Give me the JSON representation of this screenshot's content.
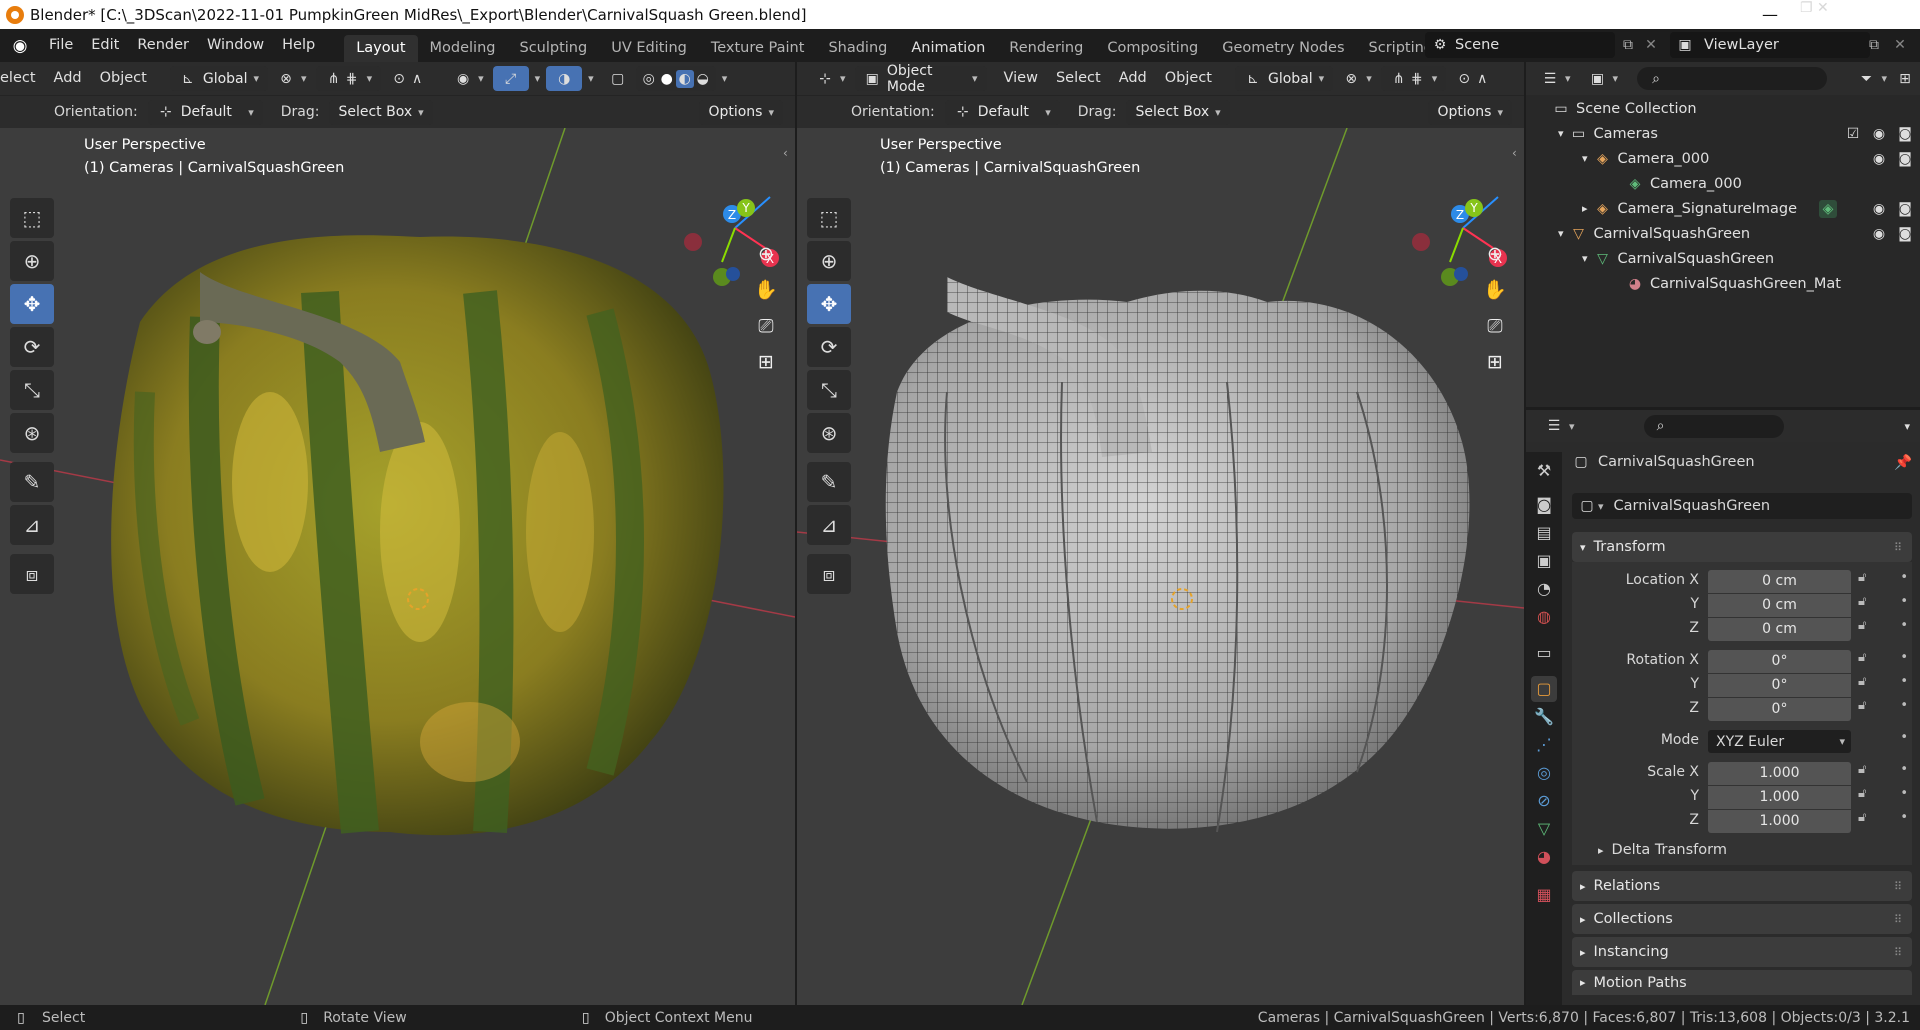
{
  "titlebar": {
    "title": "Blender* [C:\\_3DScan\\2022-11-01 PumpkinGreen MidRes\\_Export\\Blender\\CarnivalSquash Green.blend]",
    "minimize": "—",
    "maximize": "❐",
    "close": "✕"
  },
  "menubar": {
    "items": [
      "File",
      "Edit",
      "Render",
      "Window",
      "Help"
    ]
  },
  "workspaces": [
    "Layout",
    "Modeling",
    "Sculpting",
    "UV Editing",
    "Texture Paint",
    "Shading",
    "Animation",
    "Rendering",
    "Compositing",
    "Geometry Nodes",
    "Scripting"
  ],
  "add_workspace": "+",
  "scene": {
    "label": "Scene"
  },
  "view_layer": {
    "label": "ViewLayer"
  },
  "viewport_left": {
    "header": [
      "elect",
      "Add",
      "Object"
    ],
    "transform": "Global",
    "orientation_label": "Orientation:",
    "orientation_value": "Default",
    "drag_label": "Drag:",
    "drag_value": "Select Box",
    "options": "Options",
    "info_line1": "User Perspective",
    "info_line2": "(1) Cameras | CarnivalSquashGreen"
  },
  "viewport_right": {
    "mode": "Object Mode",
    "header": [
      "View",
      "Select",
      "Add",
      "Object"
    ],
    "transform": "Global",
    "orientation_label": "Orientation:",
    "orientation_value": "Default",
    "drag_label": "Drag:",
    "drag_value": "Select Box",
    "options": "Options",
    "info_line1": "User Perspective",
    "info_line2": "(1) Cameras | CarnivalSquashGreen"
  },
  "gizmo": {
    "z": "Z",
    "y": "Y",
    "x": "X"
  },
  "outliner": {
    "root": "Scene Collection",
    "rows": [
      {
        "label": "Cameras",
        "kind": "collection"
      },
      {
        "label": "Camera_000",
        "kind": "camera-object"
      },
      {
        "label": "Camera_000",
        "kind": "camera-data"
      },
      {
        "label": "Camera_SignatureImage",
        "kind": "camera-object"
      },
      {
        "label": "CarnivalSquashGreen",
        "kind": "collection"
      },
      {
        "label": "CarnivalSquashGreen",
        "kind": "mesh"
      },
      {
        "label": "CarnivalSquashGreen_Mat",
        "kind": "material"
      }
    ]
  },
  "properties": {
    "object_name": "CarnivalSquashGreen",
    "datablock": "CarnivalSquashGreen",
    "transform_title": "Transform",
    "location_label": "Location X",
    "rotation_label": "Rotation X",
    "scale_label": "Scale X",
    "y_label": "Y",
    "z_label": "Z",
    "location": [
      "0 cm",
      "0 cm",
      "0 cm"
    ],
    "rotation": [
      "0°",
      "0°",
      "0°"
    ],
    "mode_label": "Mode",
    "mode_value": "XYZ Euler",
    "scale": [
      "1.000",
      "1.000",
      "1.000"
    ],
    "delta": "Delta Transform",
    "sections": [
      "Relations",
      "Collections",
      "Instancing",
      "Motion Paths"
    ]
  },
  "statusbar": {
    "select": "Select",
    "rotate": "Rotate View",
    "context": "Object Context Menu",
    "stats": "Cameras | CarnivalSquashGreen | Verts:6,870 | Faces:6,807 | Tris:13,608 | Objects:0/3 | 3.2.1"
  },
  "colors": {
    "accent": "#4772b3",
    "axis_x": "#ff3352",
    "axis_y": "#8bdc00",
    "axis_z": "#2890ff"
  }
}
